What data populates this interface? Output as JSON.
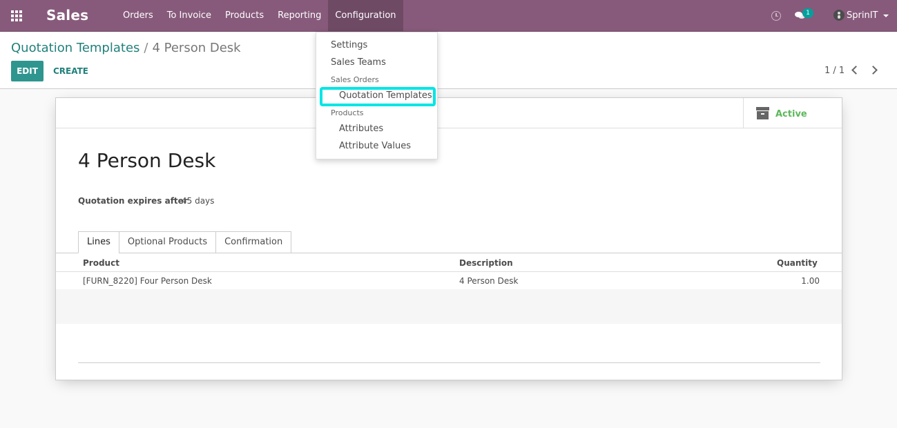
{
  "navbar": {
    "app_name": "Sales",
    "menu": [
      "Orders",
      "To Invoice",
      "Products",
      "Reporting",
      "Configuration"
    ],
    "active_menu": "Configuration",
    "message_count": "1",
    "user_name": "SprinIT"
  },
  "breadcrumb": {
    "parent": "Quotation Templates",
    "separator": "/",
    "current": "4 Person Desk"
  },
  "buttons": {
    "edit": "EDIT",
    "create": "CREATE"
  },
  "pager": {
    "text": "1 / 1"
  },
  "status": {
    "active": "Active"
  },
  "record": {
    "title": "4 Person Desk",
    "field_label": "Quotation expires after",
    "field_value": "45 days"
  },
  "tabs": [
    "Lines",
    "Optional Products",
    "Confirmation"
  ],
  "table": {
    "headers": {
      "product": "Product",
      "description": "Description",
      "quantity": "Quantity"
    },
    "rows": [
      {
        "product": "[FURN_8220] Four Person Desk",
        "description": "4 Person Desk",
        "quantity": "1.00"
      }
    ]
  },
  "dropdown": {
    "settings": "Settings",
    "sales_teams": "Sales Teams",
    "section_sales_orders": "Sales Orders",
    "quotation_templates": "Quotation Templates",
    "section_products": "Products",
    "attributes": "Attributes",
    "attribute_values": "Attribute Values",
    "highlight_color": "#00e5e5"
  },
  "colors": {
    "navbar": "#875a7b",
    "primary": "#2f958f",
    "link": "#21807b",
    "active_status": "#5cb85c"
  }
}
